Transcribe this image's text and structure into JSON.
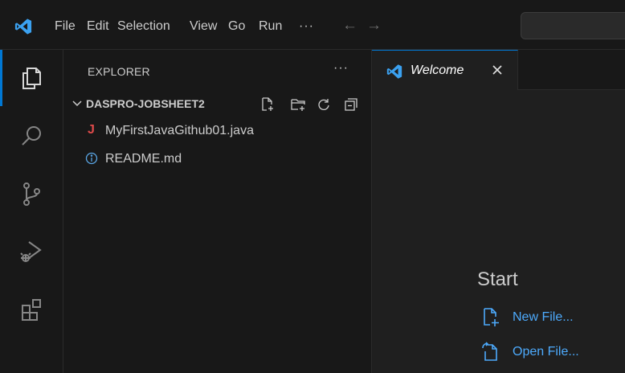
{
  "menu": {
    "file": "File",
    "edit": "Edit",
    "selection": "Selection",
    "view": "View",
    "go": "Go",
    "run": "Run",
    "more": "···",
    "back": "←",
    "forward": "→"
  },
  "sidebar": {
    "title": "EXPLORER",
    "more": "···",
    "folder": "DASPRO-JOBSHEET2",
    "files": [
      {
        "icon": "J",
        "name": "MyFirstJavaGithub01.java"
      },
      {
        "icon": "info-icon",
        "name": "README.md"
      }
    ]
  },
  "tab": {
    "label": "Welcome"
  },
  "welcome": {
    "start_heading": "Start",
    "new_file": "New File...",
    "open_file": "Open File..."
  },
  "colors": {
    "accent": "#0078d4",
    "link": "#4daafc",
    "java_icon": "#e04b4b"
  }
}
